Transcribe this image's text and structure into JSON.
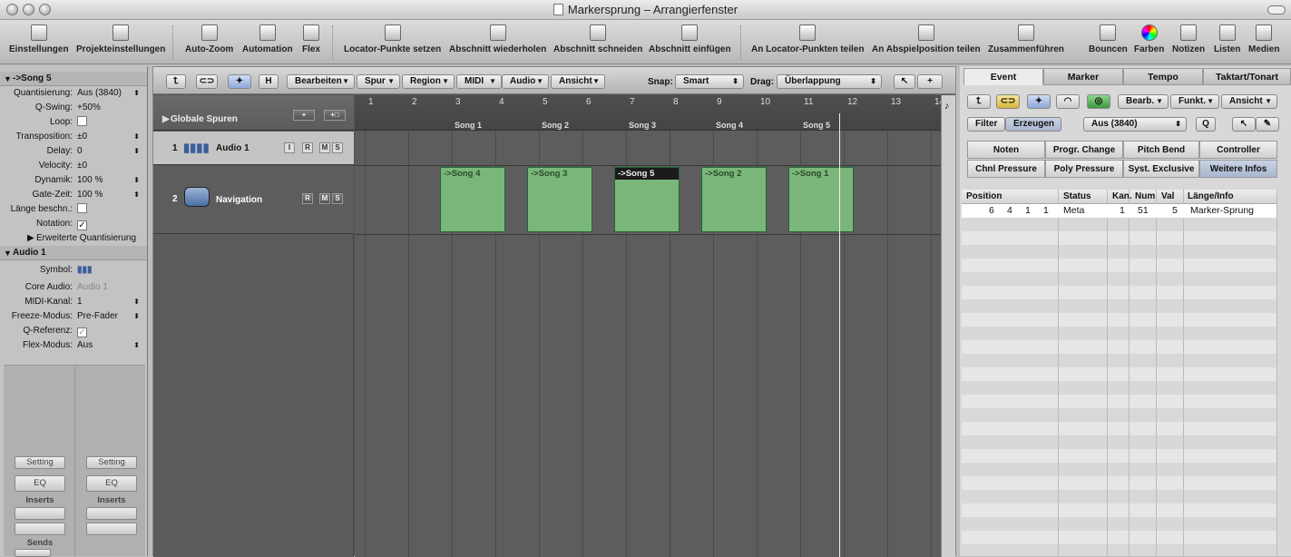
{
  "window": {
    "title": "Markersprung – Arrangierfenster"
  },
  "toolbar": {
    "items": [
      "Einstellungen",
      "Projekteinstellungen",
      "Auto-Zoom",
      "Automation",
      "Flex",
      "Locator-Punkte setzen",
      "Abschnitt wiederholen",
      "Abschnitt schneiden",
      "Abschnitt einfügen",
      "An Locator-Punkten teilen",
      "An Abspielposition teilen",
      "Zusammenführen",
      "Bouncen",
      "Farben",
      "Notizen",
      "Listen",
      "Medien"
    ]
  },
  "inspector": {
    "region": {
      "title": "->Song 5",
      "params": [
        {
          "k": "Quantisierung:",
          "v": "Aus (3840)"
        },
        {
          "k": "Q-Swing:",
          "v": "+50%"
        },
        {
          "k": "Loop:",
          "v": ""
        },
        {
          "k": "Transposition:",
          "v": "±0"
        },
        {
          "k": "Delay:",
          "v": "0"
        },
        {
          "k": "Velocity:",
          "v": "±0"
        },
        {
          "k": "Dynamik:",
          "v": "100 %"
        },
        {
          "k": "Gate-Zeit:",
          "v": "100 %"
        },
        {
          "k": "Länge beschn.:",
          "v": ""
        },
        {
          "k": "Notation:",
          "v": "✓"
        }
      ],
      "expand": "Erweiterte Quantisierung"
    },
    "track": {
      "title": "Audio 1",
      "params": [
        {
          "k": "Symbol:",
          "v": ""
        },
        {
          "k": "Core Audio:",
          "v": "Audio 1"
        },
        {
          "k": "MIDI-Kanal:",
          "v": "1"
        },
        {
          "k": "Freeze-Modus:",
          "v": "Pre-Fader"
        },
        {
          "k": "Q-Referenz:",
          "v": "✓"
        },
        {
          "k": "Flex-Modus:",
          "v": "Aus"
        }
      ]
    },
    "strip": {
      "setting": "Setting",
      "eq": "EQ",
      "inserts": "Inserts",
      "sends": "Sends"
    }
  },
  "arrange": {
    "menus": [
      "Bearbeiten",
      "Spur",
      "Region",
      "MIDI",
      "Audio",
      "Ansicht"
    ],
    "btn_h": "H",
    "snap_label": "Snap:",
    "snap_value": "Smart",
    "drag_label": "Drag:",
    "drag_value": "Überlappung",
    "global_tracks": "Globale Spuren",
    "tracks": [
      {
        "num": "1",
        "name": "Audio 1"
      },
      {
        "num": "2",
        "name": "Navigation"
      }
    ],
    "bars": [
      "1",
      "2",
      "3",
      "4",
      "5",
      "6",
      "7",
      "8",
      "9",
      "10",
      "11",
      "12",
      "13",
      "14"
    ],
    "markers": [
      "Song 1",
      "Song 2",
      "Song 3",
      "Song 4",
      "Song 5"
    ],
    "regions": [
      "->Song 4",
      "->Song 3",
      "->Song 5",
      "->Song 2",
      "->Song 1"
    ]
  },
  "events": {
    "tabs": [
      "Event",
      "Marker",
      "Tempo",
      "Taktart/Tonart"
    ],
    "dropdowns": [
      "Bearb.",
      "Funkt.",
      "Ansicht"
    ],
    "filter": "Filter",
    "create": "Erzeugen",
    "quant": "Aus (3840)",
    "q": "Q",
    "types": [
      "Noten",
      "Progr. Change",
      "Pitch Bend",
      "Controller",
      "Chnl Pressure",
      "Poly Pressure",
      "Syst. Exclusive",
      "Weitere Infos"
    ],
    "columns": [
      "Position",
      "Status",
      "Kan.",
      "Num",
      "Val",
      "Länge/Info"
    ],
    "row": {
      "pos": [
        "6",
        "4",
        "1",
        "1"
      ],
      "status": "Meta",
      "ch": "1",
      "num": "51",
      "val": "5",
      "info": "Marker-Sprung"
    }
  }
}
